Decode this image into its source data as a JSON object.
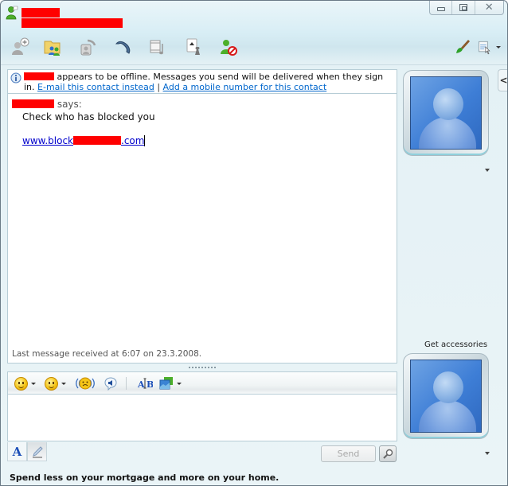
{
  "window": {
    "title_contact_name": "[redacted]",
    "title_status_message": "[redacted]",
    "controls": {
      "minimize": "minimize",
      "maximize": "maximize",
      "close": "close"
    }
  },
  "toolbar": {
    "items": [
      {
        "name": "invite-contact",
        "icon": "add-contact-icon",
        "tooltip": "Invite someone to this conversation"
      },
      {
        "name": "send-files",
        "icon": "shared-folder-icon",
        "tooltip": "Send files or photos"
      },
      {
        "name": "video-call",
        "icon": "webcam-call-icon",
        "tooltip": "Start a video call"
      },
      {
        "name": "voice-call",
        "icon": "phone-icon",
        "tooltip": "Call a contact"
      },
      {
        "name": "activities",
        "icon": "media-icon",
        "tooltip": "Start an activity"
      },
      {
        "name": "games",
        "icon": "games-icon",
        "tooltip": "Play a game"
      },
      {
        "name": "block-contact",
        "icon": "block-contact-icon",
        "tooltip": "Block this contact"
      }
    ],
    "right_items": [
      {
        "name": "theme",
        "icon": "paintbrush-icon"
      },
      {
        "name": "show-menu",
        "icon": "menu-icon"
      }
    ]
  },
  "info_bar": {
    "contact": "[redacted]",
    "message": "appears to be offline. Messages you send will be delivered when they sign in.",
    "email_link": "E-mail this contact instead",
    "separator": "|",
    "mobile_link": "Add a mobile number for this contact"
  },
  "conversation": {
    "sender": "[redacted]",
    "says_label": "says:",
    "message": "Check who has blocked you",
    "link_prefix": "www.block",
    "link_suffix": ".com",
    "last_message": "Last message received at 6:07 on 23.3.2008."
  },
  "input_toolbar": {
    "items": [
      {
        "name": "emoticons",
        "icon": "smiley-icon",
        "has_dropdown": true
      },
      {
        "name": "winks",
        "icon": "wink-icon",
        "has_dropdown": true
      },
      {
        "name": "nudge",
        "icon": "nudge-icon",
        "has_dropdown": false
      },
      {
        "name": "voice-clip",
        "icon": "voice-clip-icon",
        "has_dropdown": false
      },
      {
        "name": "font",
        "icon": "font-icon",
        "has_dropdown": false
      },
      {
        "name": "background",
        "icon": "background-icon",
        "has_dropdown": true
      }
    ]
  },
  "input": {
    "value": "",
    "placeholder": ""
  },
  "format_tabs": [
    {
      "name": "font-tab",
      "label": "A"
    },
    {
      "name": "handwriting-tab",
      "label": ""
    }
  ],
  "send_button": "Send",
  "ad_text": "Spend less on your mortgage and more on your home.",
  "sidebar": {
    "get_accessories": "Get accessories",
    "collapse_label": "<"
  }
}
